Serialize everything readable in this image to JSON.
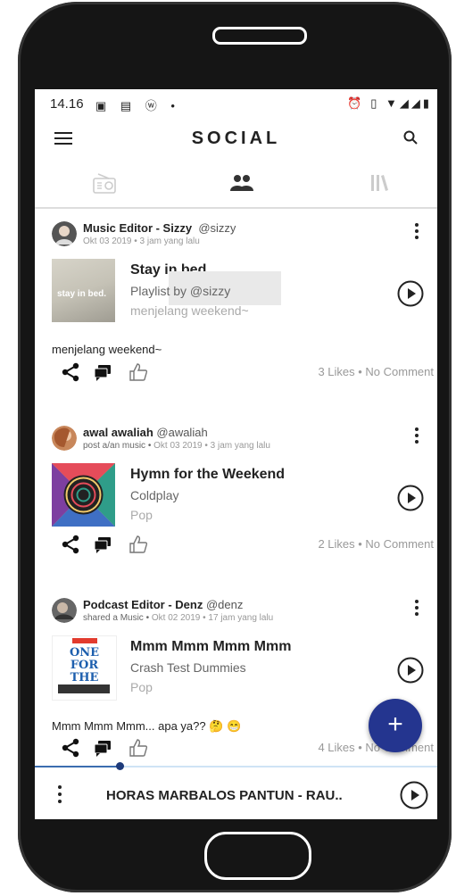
{
  "status_bar": {
    "time": "14.16",
    "left_icons": "▣ ▤ ⓦ •",
    "right_icons": "⏰ ▯ ▼◢◢▮"
  },
  "app_bar": {
    "title": "SOCIAL"
  },
  "posts": [
    {
      "author": "Music Editor - Sizzy",
      "handle": "@sizzy",
      "activity": "",
      "date": "Okt 03 2019 • 3 jam yang lalu",
      "song_title": "Stay in bed",
      "song_artist": "Playlist by @sizzy",
      "song_genre": "menjelang weekend~",
      "cover_text": "stay in bed.",
      "caption": "menjelang weekend~",
      "stats": "3 Likes • No Comment"
    },
    {
      "author": "awal awaliah",
      "handle": "@awaliah",
      "activity": "post a/an music •",
      "date": "Okt 03 2019 • 3 jam yang lalu",
      "song_title": "Hymn for the Weekend",
      "song_artist": "Coldplay",
      "song_genre": "Pop",
      "caption": "",
      "stats": "2 Likes • No Comment"
    },
    {
      "author": "Podcast Editor - Denz",
      "handle": "@denz",
      "activity": "shared a Music •",
      "date": "Okt 02 2019 • 17 jam yang lalu",
      "song_title": "Mmm Mmm Mmm Mmm",
      "song_artist": "Crash Test Dummies",
      "song_genre": "Pop",
      "cover_text": "ONE FOR THE LADS",
      "caption": "Mmm Mmm Mmm... apa ya?? 🤔 😁",
      "stats": "4 Likes • No Comment"
    }
  ],
  "player": {
    "now_playing": "HORAS MARBALOS PANTUN - RAU..",
    "progress": 0.21
  },
  "fab": {
    "label": "+"
  },
  "colors": {
    "accent": "#24358f",
    "progress": "#3b6db0"
  }
}
